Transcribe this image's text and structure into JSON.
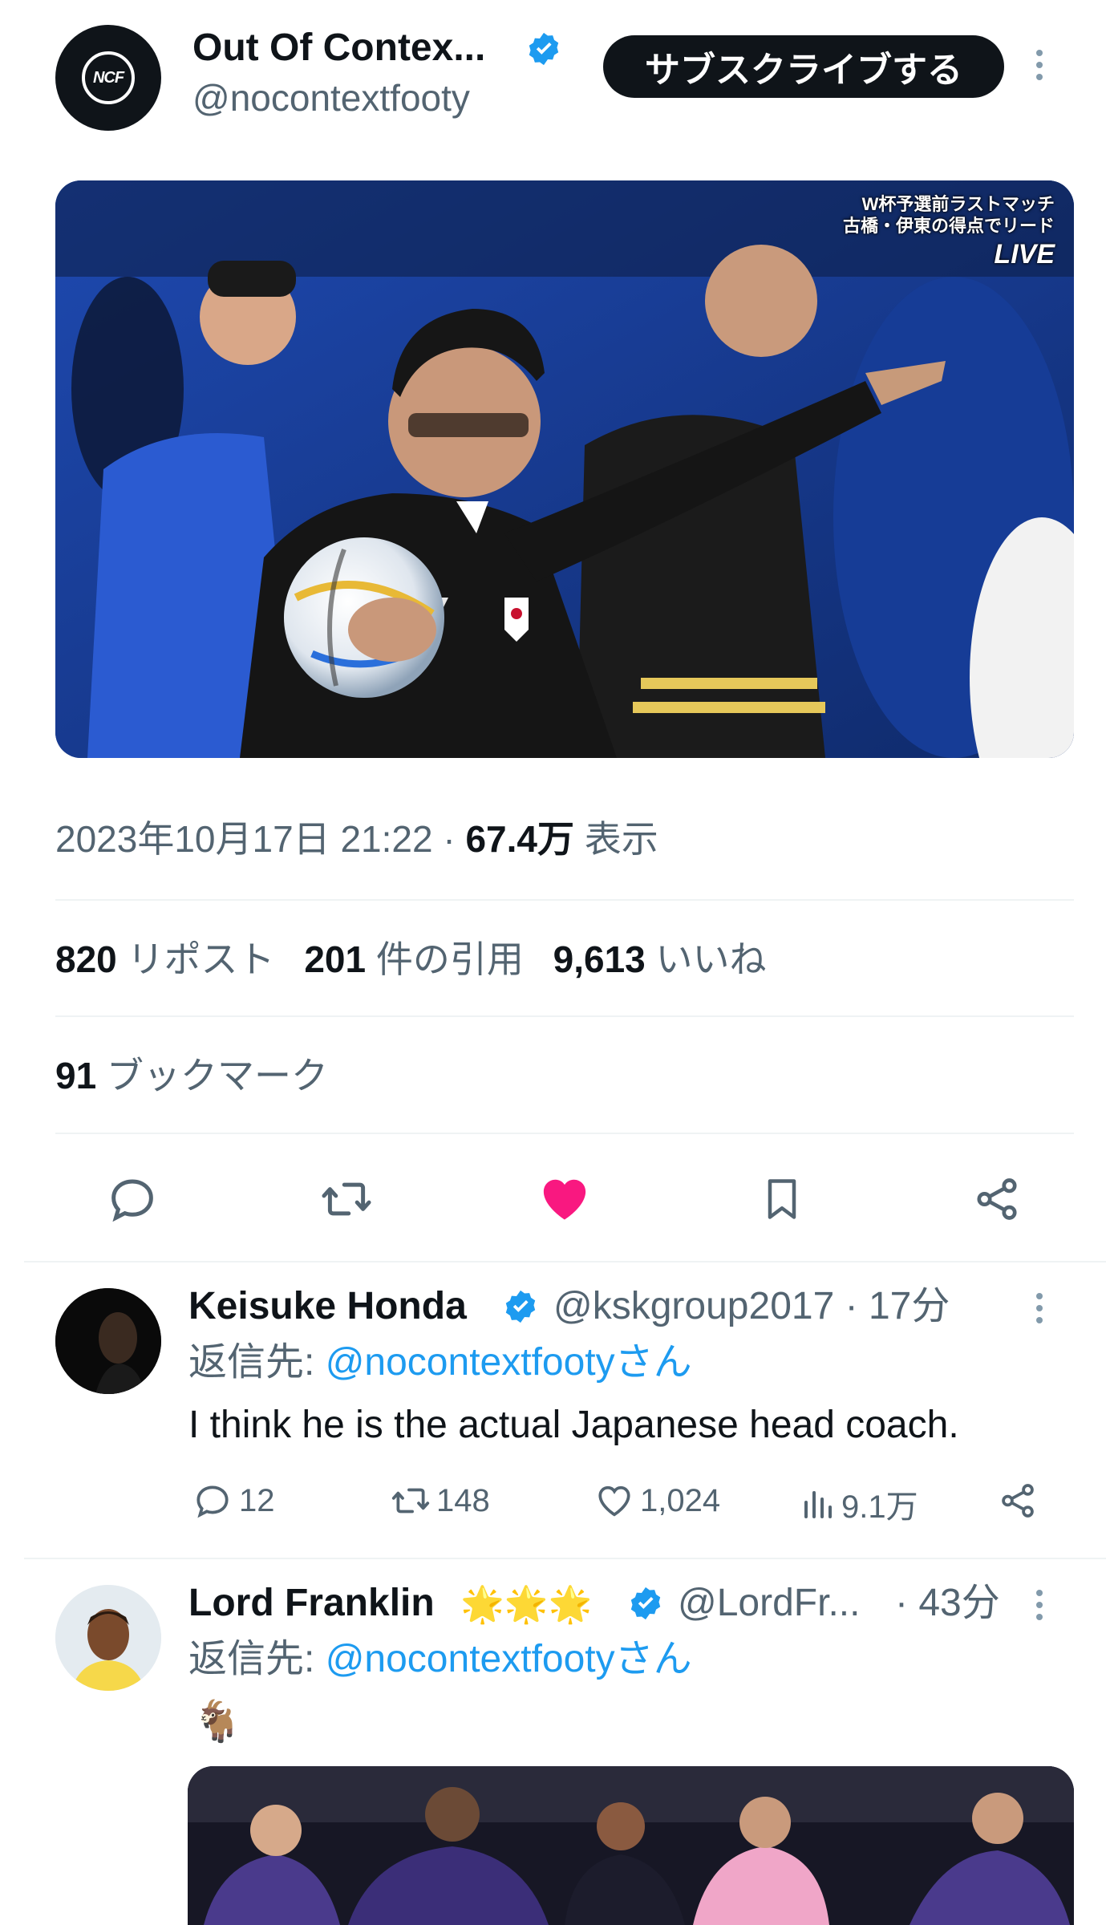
{
  "header": {
    "display_name": "Out Of Contex...",
    "handle": "@nocontextfooty",
    "logo_text": "NCF",
    "subscribe_label": "サブスクライブする"
  },
  "media_overlay": {
    "line1": "W杯予選前ラストマッチ",
    "line2": "古橋・伊東の得点でリード",
    "live": "LIVE"
  },
  "post_meta": {
    "datetime": "2023年10月17日 21:22",
    "separator": "·",
    "views_count": "67.4万",
    "views_label": "表示"
  },
  "stats": {
    "reposts_count": "820",
    "reposts_label": "リポスト",
    "quotes_count": "201",
    "quotes_label": "件の引用",
    "likes_count": "9,613",
    "likes_label": "いいね",
    "bookmarks_count": "91",
    "bookmarks_label": "ブックマーク"
  },
  "replies": [
    {
      "name": "Keisuke Honda",
      "handle": "@kskgroup2017",
      "time": "· 17分",
      "reply_prefix": "返信先:",
      "reply_to": "@nocontextfootyさん",
      "text": "I think he is the actual Japanese head coach.",
      "replies": "12",
      "reposts": "148",
      "likes": "1,024",
      "views": "9.1万"
    },
    {
      "name": "Lord Franklin",
      "badges": "🌟🌟🌟",
      "handle": "@LordFr...",
      "time": "· 43分",
      "reply_prefix": "返信先:",
      "reply_to": "@nocontextfootyさん",
      "text": "🐐"
    }
  ],
  "colors": {
    "accent": "#1d9bf0",
    "like_pink": "#f91880",
    "text_primary": "#0f1419",
    "text_secondary": "#536471",
    "divider": "#eff3f4"
  }
}
